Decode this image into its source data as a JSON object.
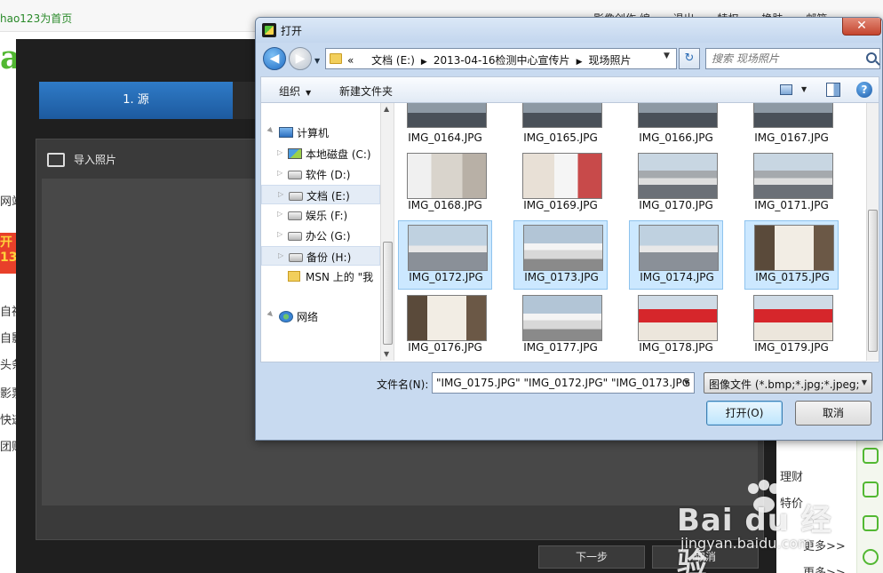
{
  "browser": {
    "home_link": "hao123为首页",
    "top_links": [
      "影像创作 编",
      "退出",
      "特权",
      "换肤",
      "邮箱"
    ],
    "left_strip": [
      "网站",
      "自视",
      "自影",
      "头条",
      "影票",
      "快递",
      "团购"
    ],
    "promo_text": "开 13",
    "right_strip": [
      "理财",
      "特价",
      "更多>>",
      "更多>>"
    ]
  },
  "watermark": {
    "brand": "Bai du 经验",
    "url": "jingyan.baidu.com"
  },
  "app": {
    "wizard_step": "1. 源",
    "panel_title": "导入照片",
    "next_label": "下一步",
    "cancel_label": "取消"
  },
  "dialog": {
    "title": "打开",
    "close_label": "✕",
    "address": {
      "prefix": "«",
      "parts": [
        "文档 (E:)",
        "2013-04-16检测中心宣传片",
        "现场照片"
      ]
    },
    "search_placeholder": "搜索 现场照片",
    "toolbar": {
      "organize_label": "组织",
      "new_folder_label": "新建文件夹"
    },
    "nav_tree": [
      {
        "label": "计算机",
        "icon": "computer-icon",
        "level": 0,
        "selected": false
      },
      {
        "label": "本地磁盘 (C:)",
        "icon": "system-drive-icon",
        "level": 1,
        "selected": false
      },
      {
        "label": "软件 (D:)",
        "icon": "drive-icon",
        "level": 1,
        "selected": false
      },
      {
        "label": "文档 (E:)",
        "icon": "drive-icon",
        "level": 1,
        "selected": true
      },
      {
        "label": "娱乐 (F:)",
        "icon": "drive-icon",
        "level": 1,
        "selected": false
      },
      {
        "label": "办公 (G:)",
        "icon": "drive-icon",
        "level": 1,
        "selected": false
      },
      {
        "label": "备份 (H:)",
        "icon": "drive-icon",
        "level": 1,
        "selected": true
      },
      {
        "label": "MSN 上的 \"我",
        "icon": "folder-icon",
        "level": 1,
        "selected": false
      },
      {
        "label": "网络",
        "icon": "network-icon",
        "level": 0,
        "selected": false
      }
    ],
    "files": [
      {
        "name": "IMG_0164.JPG",
        "selected": false,
        "art": "car"
      },
      {
        "name": "IMG_0165.JPG",
        "selected": false,
        "art": "car"
      },
      {
        "name": "IMG_0166.JPG",
        "selected": false,
        "art": "car"
      },
      {
        "name": "IMG_0167.JPG",
        "selected": false,
        "art": "car"
      },
      {
        "name": "IMG_0168.JPG",
        "selected": false,
        "art": "office"
      },
      {
        "name": "IMG_0169.JPG",
        "selected": false,
        "art": "office2"
      },
      {
        "name": "IMG_0170.JPG",
        "selected": false,
        "art": "lot"
      },
      {
        "name": "IMG_0171.JPG",
        "selected": false,
        "art": "lot"
      },
      {
        "name": "IMG_0172.JPG",
        "selected": true,
        "art": "lot2"
      },
      {
        "name": "IMG_0173.JPG",
        "selected": true,
        "art": "lot3"
      },
      {
        "name": "IMG_0174.JPG",
        "selected": true,
        "art": "lot2"
      },
      {
        "name": "IMG_0175.JPG",
        "selected": true,
        "art": "hall"
      },
      {
        "name": "IMG_0176.JPG",
        "selected": false,
        "art": "hall"
      },
      {
        "name": "IMG_0177.JPG",
        "selected": false,
        "art": "lot3"
      },
      {
        "name": "IMG_0178.JPG",
        "selected": false,
        "art": "bldg"
      },
      {
        "name": "IMG_0179.JPG",
        "selected": false,
        "art": "bldg"
      }
    ],
    "filename_label": "文件名(N):",
    "filename_value": "\"IMG_0175.JPG\" \"IMG_0172.JPG\" \"IMG_0173.JPG",
    "filetype_value": "图像文件 (*.bmp;*.jpg;*.jpeg;",
    "open_label": "打开(O)",
    "cancel_label": "取消"
  }
}
